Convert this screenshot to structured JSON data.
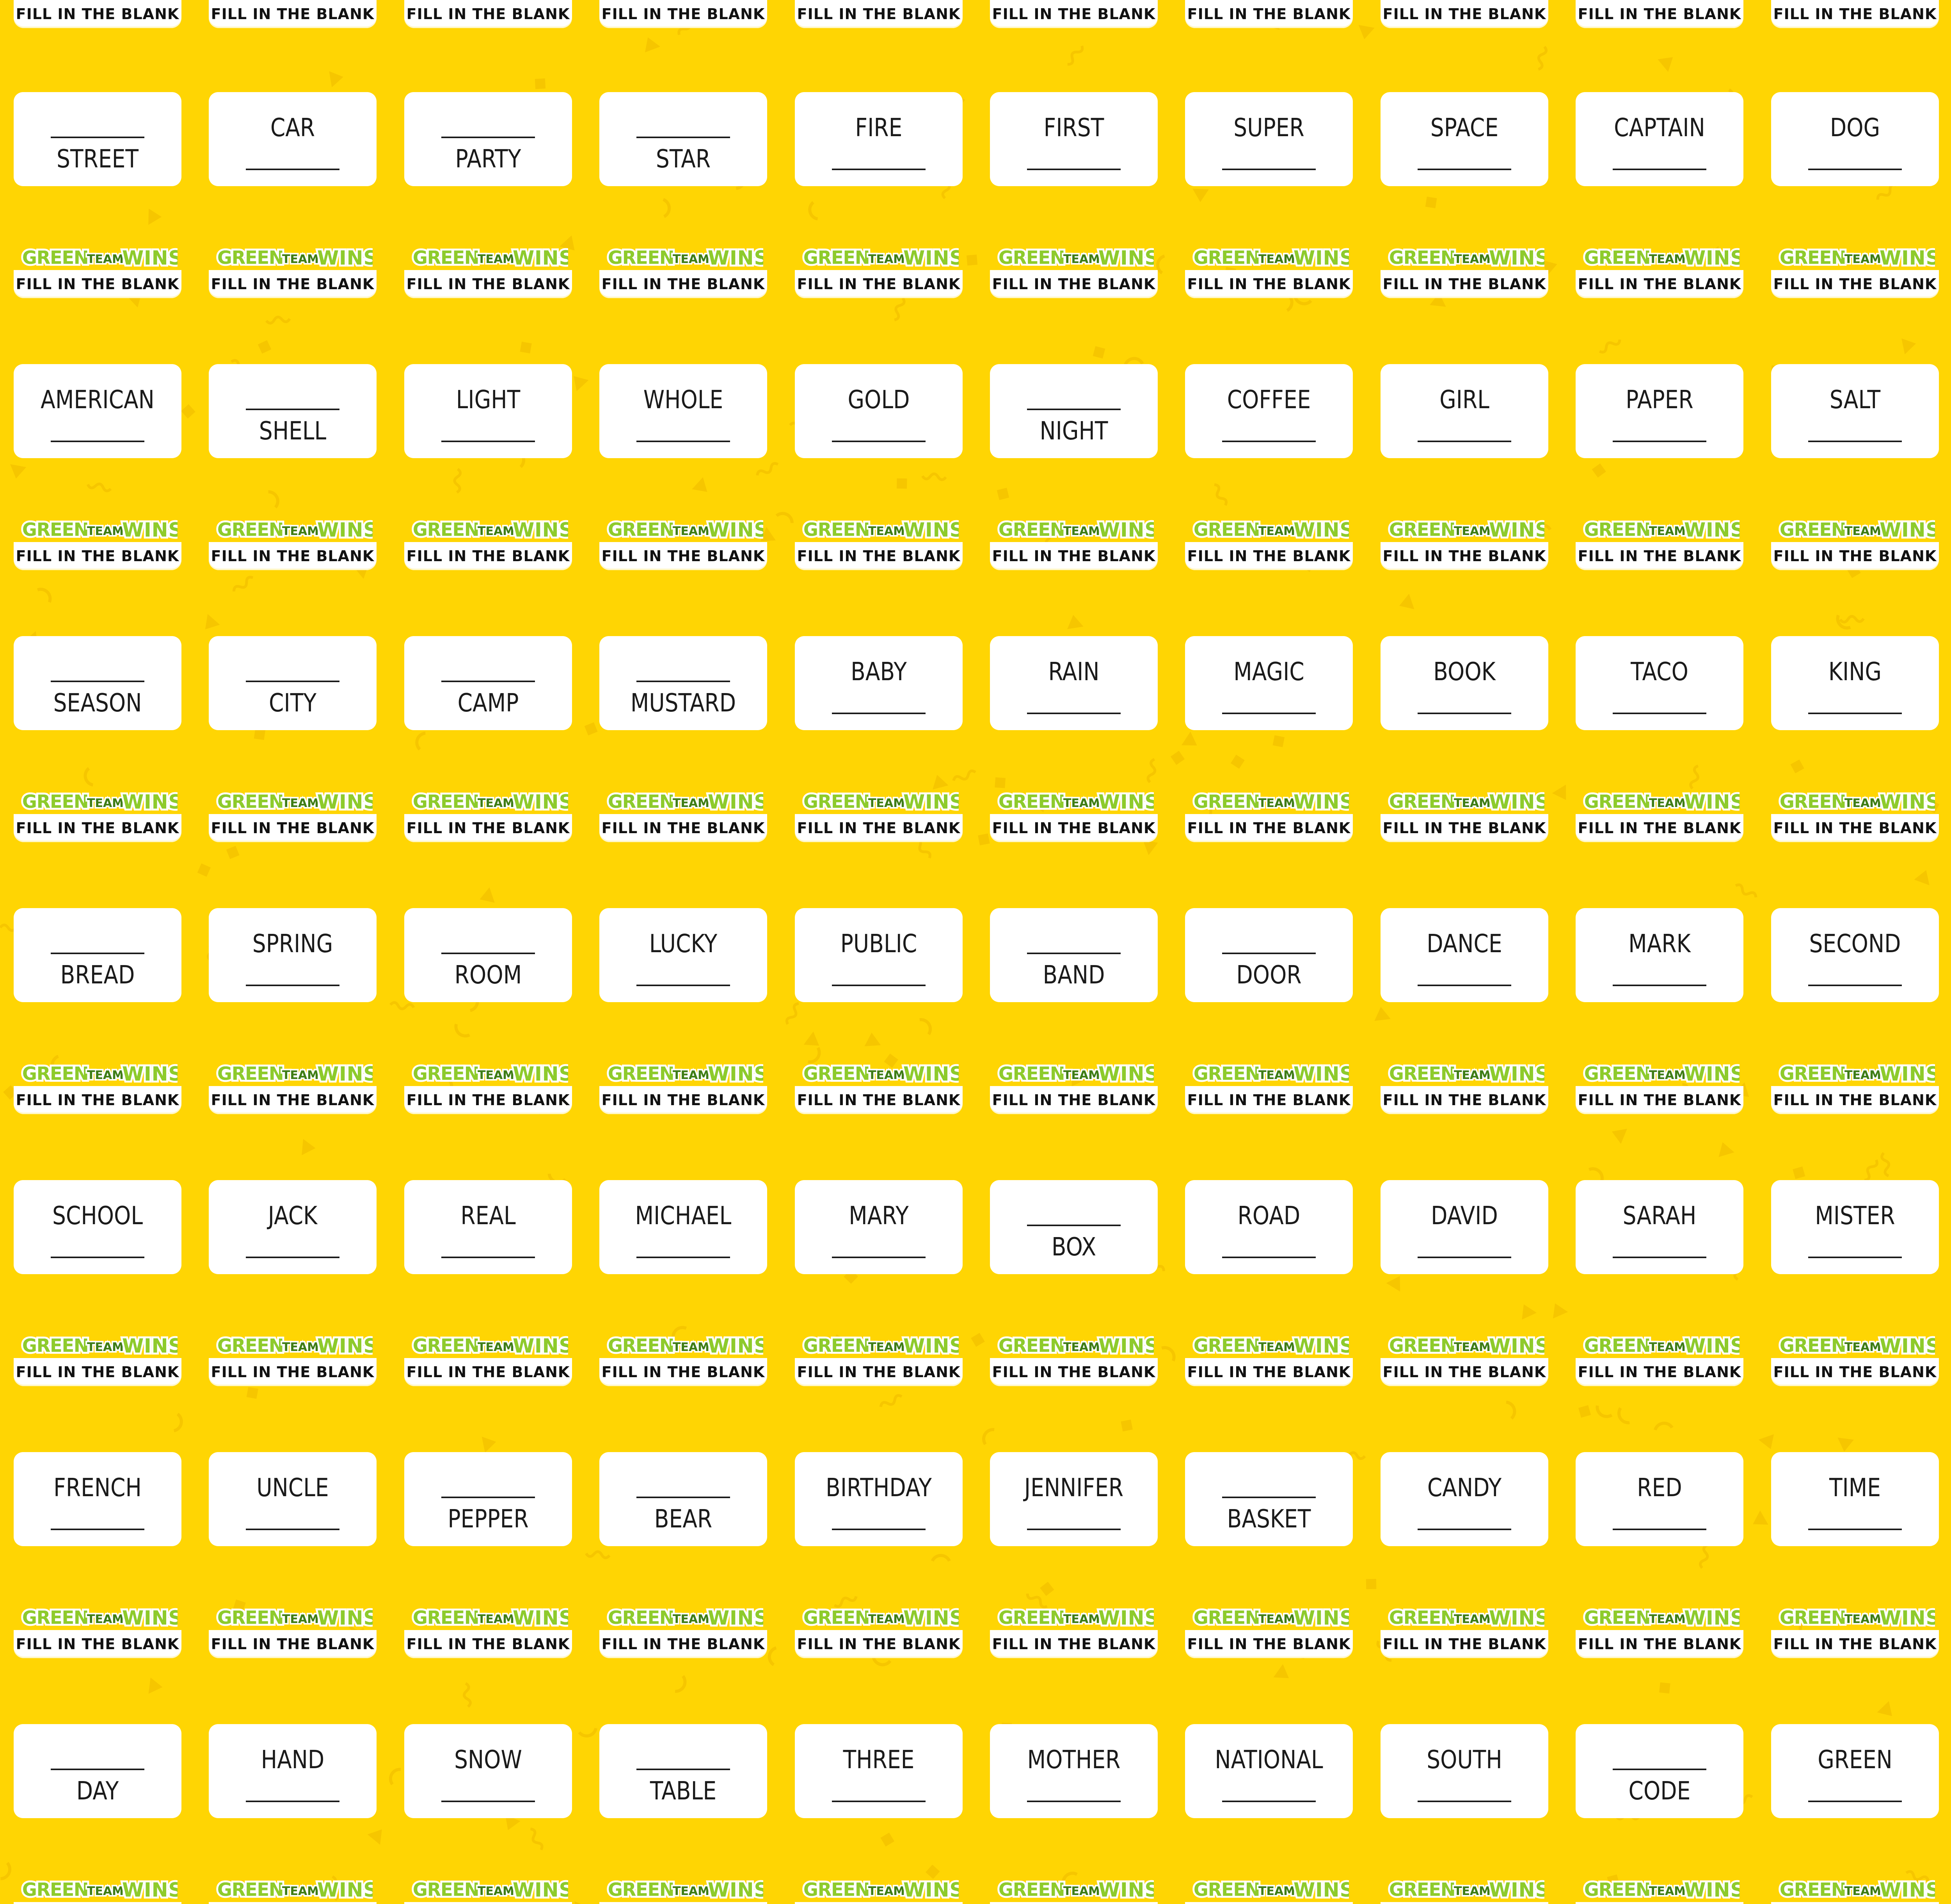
{
  "theme": {
    "background": "#ffd503",
    "pattern_color": "#f6c600",
    "card_color": "#ffffff",
    "text_color": "#1a1a1a",
    "logo_green": "#8ecb2b",
    "logo_green_dark": "#3f7d16",
    "logo_outline": "#ffffff"
  },
  "header": {
    "logo_text": {
      "green": "GREEN",
      "team": "TEAM",
      "wins": "WINS"
    },
    "subtitle": "FILL IN THE BLANK"
  },
  "blank": "______",
  "rows": [
    [
      {
        "word": "STREET",
        "blank": "before"
      },
      {
        "word": "CAR",
        "blank": "after"
      },
      {
        "word": "PARTY",
        "blank": "before"
      },
      {
        "word": "STAR",
        "blank": "before"
      },
      {
        "word": "FIRE",
        "blank": "after"
      },
      {
        "word": "FIRST",
        "blank": "after"
      },
      {
        "word": "SUPER",
        "blank": "after"
      },
      {
        "word": "SPACE",
        "blank": "after"
      },
      {
        "word": "CAPTAIN",
        "blank": "after"
      },
      {
        "word": "DOG",
        "blank": "after"
      }
    ],
    [
      {
        "word": "AMERICAN",
        "blank": "after"
      },
      {
        "word": "SHELL",
        "blank": "before"
      },
      {
        "word": "LIGHT",
        "blank": "after"
      },
      {
        "word": "WHOLE",
        "blank": "after"
      },
      {
        "word": "GOLD",
        "blank": "after"
      },
      {
        "word": "NIGHT",
        "blank": "before"
      },
      {
        "word": "COFFEE",
        "blank": "after"
      },
      {
        "word": "GIRL",
        "blank": "after"
      },
      {
        "word": "PAPER",
        "blank": "after"
      },
      {
        "word": "SALT",
        "blank": "after"
      }
    ],
    [
      {
        "word": "SEASON",
        "blank": "before"
      },
      {
        "word": "CITY",
        "blank": "before"
      },
      {
        "word": "CAMP",
        "blank": "before"
      },
      {
        "word": "MUSTARD",
        "blank": "before"
      },
      {
        "word": "BABY",
        "blank": "after"
      },
      {
        "word": "RAIN",
        "blank": "after"
      },
      {
        "word": "MAGIC",
        "blank": "after"
      },
      {
        "word": "BOOK",
        "blank": "after"
      },
      {
        "word": "TACO",
        "blank": "after"
      },
      {
        "word": "KING",
        "blank": "after"
      }
    ],
    [
      {
        "word": "BREAD",
        "blank": "before"
      },
      {
        "word": "SPRING",
        "blank": "after"
      },
      {
        "word": "ROOM",
        "blank": "before"
      },
      {
        "word": "LUCKY",
        "blank": "after"
      },
      {
        "word": "PUBLIC",
        "blank": "after"
      },
      {
        "word": "BAND",
        "blank": "before"
      },
      {
        "word": "DOOR",
        "blank": "before"
      },
      {
        "word": "DANCE",
        "blank": "after"
      },
      {
        "word": "MARK",
        "blank": "after"
      },
      {
        "word": "SECOND",
        "blank": "after"
      }
    ],
    [
      {
        "word": "SCHOOL",
        "blank": "after"
      },
      {
        "word": "JACK",
        "blank": "after"
      },
      {
        "word": "REAL",
        "blank": "after"
      },
      {
        "word": "MICHAEL",
        "blank": "after"
      },
      {
        "word": "MARY",
        "blank": "after"
      },
      {
        "word": "BOX",
        "blank": "before"
      },
      {
        "word": "ROAD",
        "blank": "after"
      },
      {
        "word": "DAVID",
        "blank": "after"
      },
      {
        "word": "SARAH",
        "blank": "after"
      },
      {
        "word": "MISTER",
        "blank": "after"
      }
    ],
    [
      {
        "word": "FRENCH",
        "blank": "after"
      },
      {
        "word": "UNCLE",
        "blank": "after"
      },
      {
        "word": "PEPPER",
        "blank": "before"
      },
      {
        "word": "BEAR",
        "blank": "before"
      },
      {
        "word": "BIRTHDAY",
        "blank": "after"
      },
      {
        "word": "JENNIFER",
        "blank": "after"
      },
      {
        "word": "BASKET",
        "blank": "before"
      },
      {
        "word": "CANDY",
        "blank": "after"
      },
      {
        "word": "RED",
        "blank": "after"
      },
      {
        "word": "TIME",
        "blank": "after"
      }
    ],
    [
      {
        "word": "DAY",
        "blank": "before"
      },
      {
        "word": "HAND",
        "blank": "after"
      },
      {
        "word": "SNOW",
        "blank": "after"
      },
      {
        "word": "TABLE",
        "blank": "before"
      },
      {
        "word": "THREE",
        "blank": "after"
      },
      {
        "word": "MOTHER",
        "blank": "after"
      },
      {
        "word": "NATIONAL",
        "blank": "after"
      },
      {
        "word": "SOUTH",
        "blank": "after"
      },
      {
        "word": "CODE",
        "blank": "before"
      },
      {
        "word": "GREEN",
        "blank": "after"
      }
    ]
  ]
}
